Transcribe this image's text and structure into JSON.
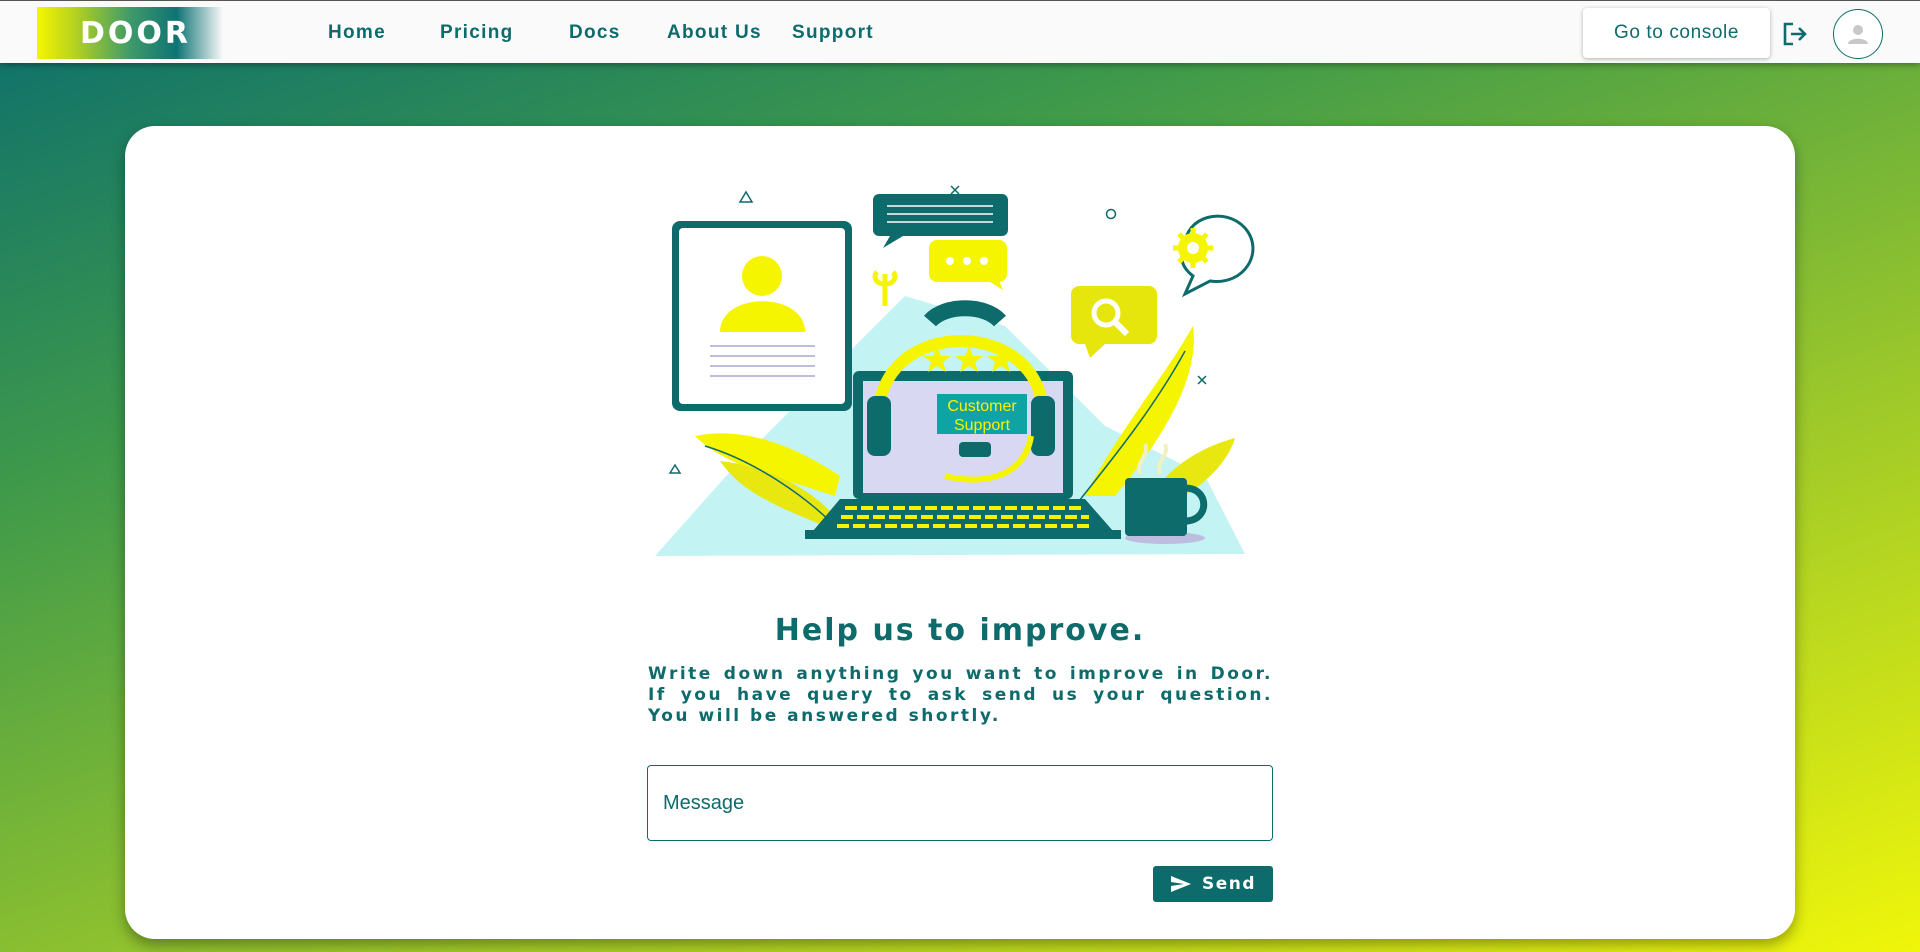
{
  "header": {
    "logo_text": "DOOR",
    "nav": [
      "Home",
      "Pricing",
      "Docs",
      "About Us",
      "Support"
    ],
    "console_label": "Go to console"
  },
  "illustration": {
    "sign_line1": "Customer",
    "sign_line2": "Support"
  },
  "feedback": {
    "heading": "Help us to improve.",
    "description": "Write down anything you want to improve in Door. If you have query to ask send us your question. You will be answered shortly.",
    "message_placeholder": "Message",
    "send_label": "Send"
  },
  "icons": {
    "logout": "logout-icon",
    "avatar": "user-icon",
    "send": "send-icon"
  },
  "colors": {
    "primary": "#0e6b6b",
    "accent": "#f5f500",
    "light_cyan": "#c4f3f3"
  }
}
